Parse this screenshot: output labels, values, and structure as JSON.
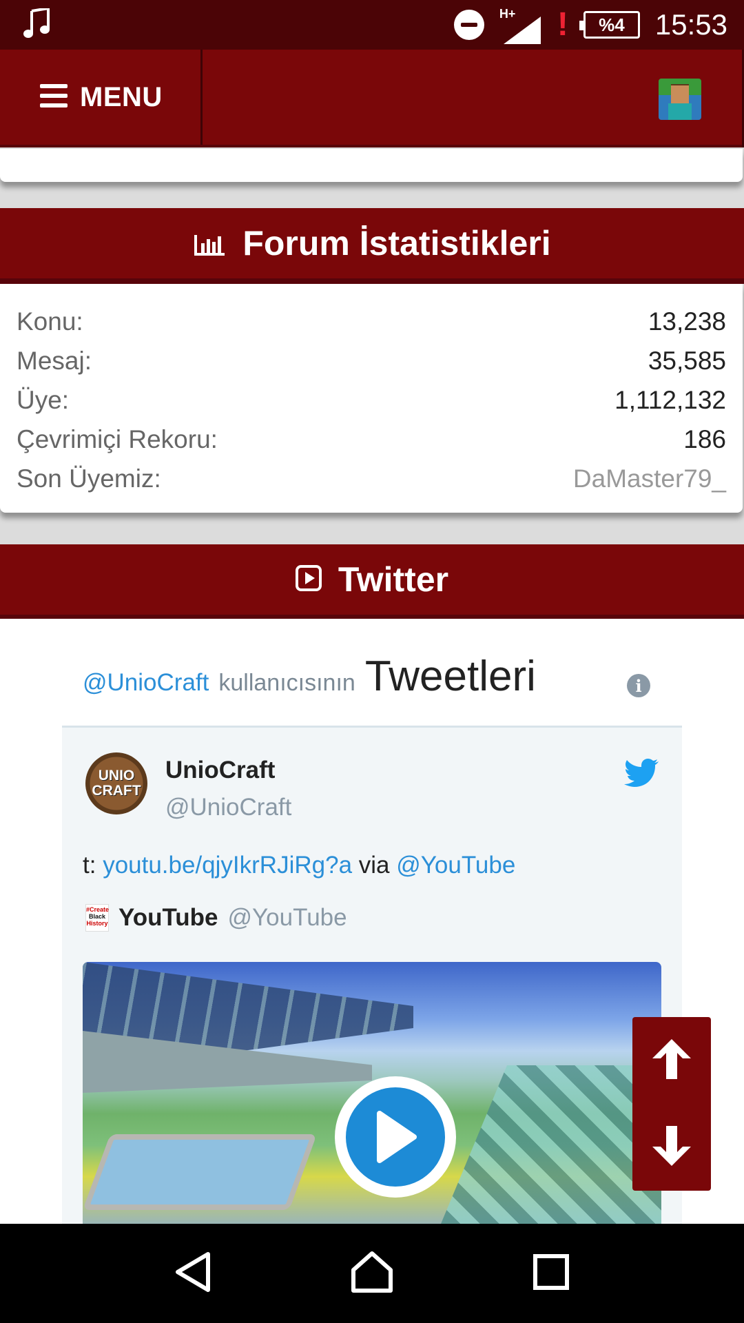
{
  "status_bar": {
    "network": "H+",
    "battery": "%4",
    "time": "15:53"
  },
  "topnav": {
    "menu_label": "MENU"
  },
  "stats": {
    "title": "Forum İstatistikleri",
    "rows": [
      {
        "label": "Konu:",
        "value": "13,238"
      },
      {
        "label": "Mesaj:",
        "value": "35,585"
      },
      {
        "label": "Üye:",
        "value": "1,112,132"
      },
      {
        "label": "Çevrimiçi Rekoru:",
        "value": "186"
      },
      {
        "label": "Son Üyemiz:",
        "value": "DaMaster79_"
      }
    ]
  },
  "twitter": {
    "title": "Twitter",
    "header_handle": "@UnioCraft",
    "header_mid": "kullanıcısının",
    "header_big": "Tweetleri",
    "tweet": {
      "avatar_text_1": "UNIO",
      "avatar_text_2": "CRAFT",
      "name": "UnioCraft",
      "username": "@UnioCraft",
      "text_prefix": "t: ",
      "link": "youtu.be/qjyIkrRJiRg?a",
      "text_via": " via ",
      "mention": "@YouTube",
      "quote_badge_1": "#Create",
      "quote_badge_2": "Black",
      "quote_badge_3": "History",
      "quote_name": "YouTube",
      "quote_user": "@YouTube"
    }
  },
  "colors": {
    "header_red": "#7a0709",
    "status_bar": "#4b0406",
    "link_blue": "#2b8fd8",
    "twitter_blue": "#1da1f2"
  }
}
